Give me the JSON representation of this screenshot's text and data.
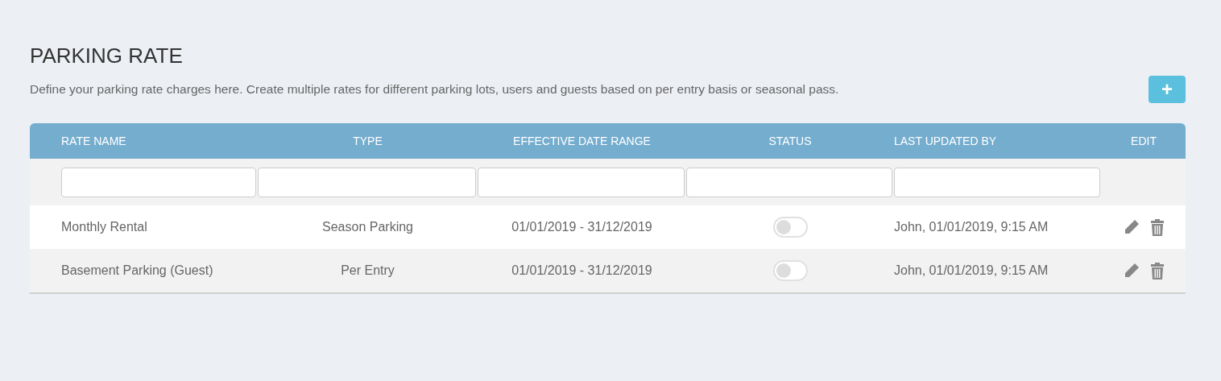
{
  "title": "PARKING RATE",
  "description": "Define your parking rate charges here. Create multiple rates for different parking lots, users and guests based on per entry basis or seasonal pass.",
  "add_button": {
    "label": "+"
  },
  "table": {
    "columns": [
      "RATE NAME",
      "TYPE",
      "EFFECTIVE DATE RANGE",
      "STATUS",
      "LAST UPDATED BY",
      "EDIT"
    ],
    "rows": [
      {
        "rate_name": "Monthly Rental",
        "type": "Season Parking",
        "date_range": "01/01/2019 - 31/12/2019",
        "status_on": false,
        "last_updated": "John, 01/01/2019, 9:15 AM"
      },
      {
        "rate_name": "Basement Parking (Guest)",
        "type": "Per Entry",
        "date_range": "01/01/2019 - 31/12/2019",
        "status_on": false,
        "last_updated": "John, 01/01/2019, 9:15 AM"
      }
    ]
  }
}
